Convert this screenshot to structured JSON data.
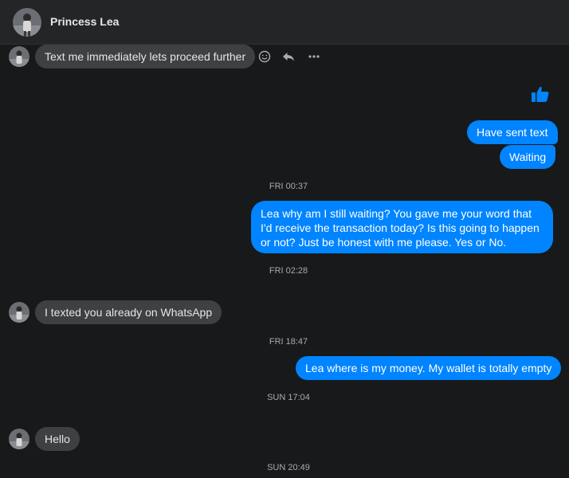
{
  "header": {
    "contact_name": "Princess Lea",
    "avatar_icon": "profile-photo"
  },
  "colors": {
    "outgoing_bubble": "#0084ff",
    "incoming_bubble": "#3e4042",
    "background": "#18191a",
    "header": "#242526"
  },
  "messages": {
    "m1": {
      "text": "Text me immediately lets proceed further",
      "sender": "contact"
    },
    "like": {
      "icon": "thumbs-up-icon",
      "sender": "me"
    },
    "m2": {
      "text": "Have sent text",
      "sender": "me"
    },
    "m3": {
      "text": "Waiting",
      "sender": "me"
    },
    "ts1": "FRI 00:37",
    "m4": {
      "text": "Lea why am I still waiting? You gave me your word that I'd receive the transaction today? Is this going to happen or not? Just be honest with me please. Yes or No.",
      "sender": "me"
    },
    "ts2": "FRI 02:28",
    "m5": {
      "text": "I texted you already on WhatsApp",
      "sender": "contact"
    },
    "ts3": "FRI 18:47",
    "m6": {
      "text": "Lea where is my money. My wallet is totally empty",
      "sender": "me"
    },
    "ts4": "SUN 17:04",
    "m7": {
      "text": "Hello",
      "sender": "contact"
    },
    "ts5": "SUN 20:49"
  },
  "message_actions": [
    "react-icon",
    "reply-icon",
    "more-icon"
  ]
}
